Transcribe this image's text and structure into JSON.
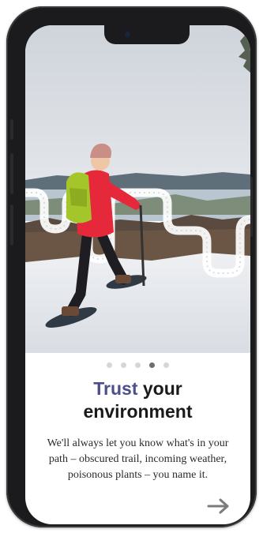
{
  "onboarding": {
    "title_accent": "Trust",
    "title_rest": " your",
    "title_line2": "environment",
    "description": "We'll always let you know what's in your path – obscured trail, incoming weather, poisonous plants – you name it.",
    "pagination": {
      "total": 5,
      "active_index": 3
    },
    "next_icon": "arrow-right-icon",
    "hero_image": "snowshoe-hiker-photo"
  },
  "colors": {
    "accent": "#4c4f8c",
    "dot_active": "#6e6e6e",
    "dot_inactive": "#d6d6d6"
  }
}
